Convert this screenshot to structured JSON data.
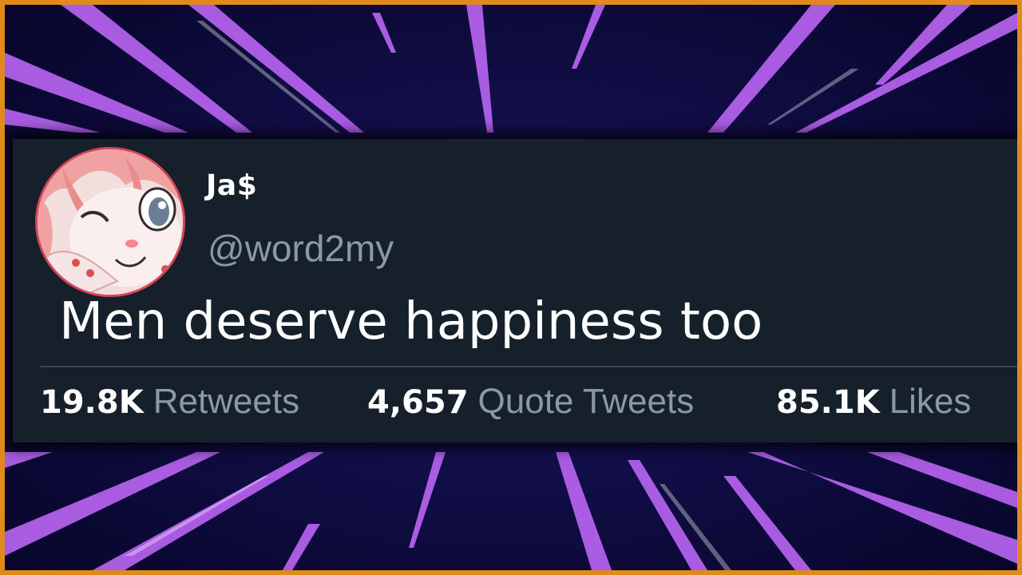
{
  "tweet": {
    "display_name": "Ja$",
    "handle": "@word2my",
    "text": "Men deserve happiness too",
    "stats": [
      {
        "count": "19.8K",
        "label": "Retweets"
      },
      {
        "count": "4,657",
        "label": "Quote Tweets"
      },
      {
        "count": "85.1K",
        "label": "Likes"
      }
    ]
  },
  "colors": {
    "frame_border": "#e08a1e",
    "card_background": "#15202b",
    "secondary_text": "#8b98a5",
    "ray_accent": "#c061ff"
  },
  "icons": {
    "avatar": "anime-girl-winking-avatar"
  }
}
